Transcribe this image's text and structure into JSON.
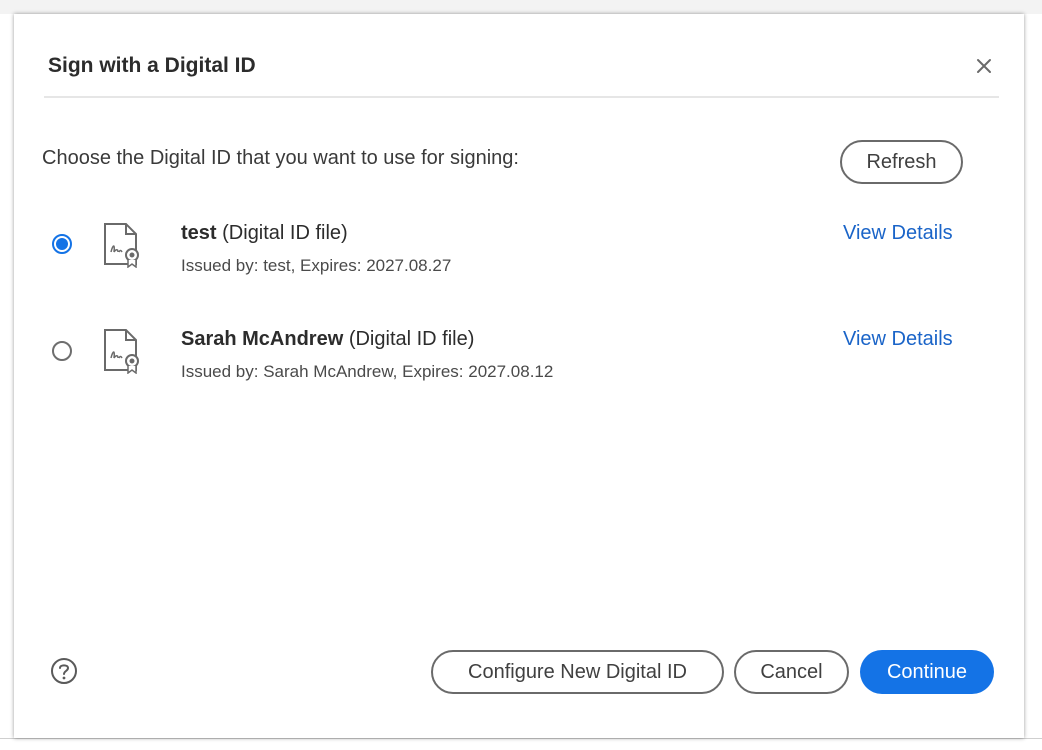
{
  "dialog": {
    "title": "Sign with a Digital ID",
    "instruction": "Choose the Digital ID that you want to use for signing:",
    "refresh_label": "Refresh",
    "close_icon": "close-icon",
    "help_icon": "help-icon"
  },
  "ids": [
    {
      "name": "test",
      "type": "(Digital ID file)",
      "issued": "Issued by: test, Expires: 2027.08.27",
      "selected": true,
      "link": "View Details"
    },
    {
      "name": "Sarah McAndrew",
      "type": "(Digital ID file)",
      "issued": "Issued by: Sarah McAndrew, Expires: 2027.08.12",
      "selected": false,
      "link": "View Details"
    }
  ],
  "footer": {
    "configure_label": "Configure New Digital ID",
    "cancel_label": "Cancel",
    "continue_label": "Continue"
  },
  "colors": {
    "accent": "#1473e6",
    "link": "#1a64c8"
  }
}
